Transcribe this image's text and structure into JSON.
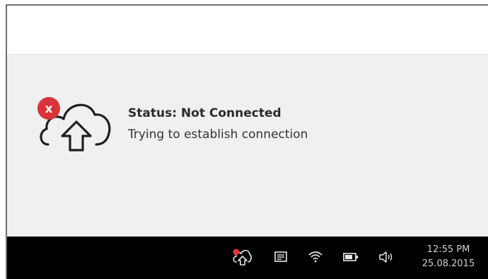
{
  "notification": {
    "title": "Status: Not Connected",
    "message": "Trying to establish connection",
    "icon": "cloud-upload-error-icon",
    "error_badge": "x",
    "error_color": "#d9343b"
  },
  "taskbar": {
    "tray_icons": [
      {
        "name": "cloud-upload-error-icon"
      },
      {
        "name": "keyboard-icon"
      },
      {
        "name": "wifi-icon"
      },
      {
        "name": "battery-icon"
      },
      {
        "name": "volume-icon"
      }
    ],
    "clock": {
      "time": "12:55 PM",
      "date": "25.08.2015"
    }
  },
  "colors": {
    "taskbar_bg": "#000000",
    "notification_bg": "#f0f0f0",
    "tray_icon": "#e8e8e8"
  }
}
